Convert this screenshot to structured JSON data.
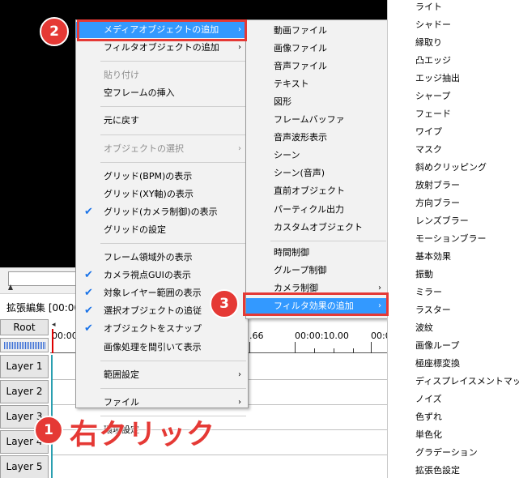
{
  "editor": {
    "title": "拡張編集 [00:00:",
    "root_label": "Root",
    "ruler_labels": [
      "00:00:",
      ".66",
      "00:00:10.00",
      "00:0"
    ],
    "layers": [
      "Layer 1",
      "Layer 2",
      "Layer 3",
      "Layer 4",
      "Layer 5"
    ]
  },
  "menu1": {
    "items": [
      {
        "label": "メディアオブジェクトの追加",
        "submenu": true,
        "highlighted": true
      },
      {
        "label": "フィルタオブジェクトの追加",
        "submenu": true
      },
      {
        "label": "貼り付け",
        "disabled": true
      },
      {
        "label": "空フレームの挿入"
      },
      {
        "label": "元に戻す"
      },
      {
        "label": "オブジェクトの選択",
        "submenu": true,
        "disabled": true
      },
      {
        "label": "グリッド(BPM)の表示"
      },
      {
        "label": "グリッド(XY軸)の表示"
      },
      {
        "label": "グリッド(カメラ制御)の表示",
        "checked": true
      },
      {
        "label": "グリッドの設定"
      },
      {
        "label": "フレーム領域外の表示"
      },
      {
        "label": "カメラ視点GUIの表示",
        "checked": true
      },
      {
        "label": "対象レイヤー範囲の表示",
        "checked": true
      },
      {
        "label": "選択オブジェクトの追従",
        "checked": true
      },
      {
        "label": "オブジェクトをスナップ",
        "checked": true
      },
      {
        "label": "画像処理を間引いて表示"
      },
      {
        "label": "範囲設定",
        "submenu": true
      },
      {
        "label": "ファイル",
        "submenu": true
      },
      {
        "label": "環境設定"
      }
    ]
  },
  "menu2": {
    "items": [
      {
        "label": "動画ファイル"
      },
      {
        "label": "画像ファイル"
      },
      {
        "label": "音声ファイル"
      },
      {
        "label": "テキスト"
      },
      {
        "label": "図形"
      },
      {
        "label": "フレームバッファ"
      },
      {
        "label": "音声波形表示"
      },
      {
        "label": "シーン"
      },
      {
        "label": "シーン(音声)"
      },
      {
        "label": "直前オブジェクト"
      },
      {
        "label": "パーティクル出力"
      },
      {
        "label": "カスタムオブジェクト"
      },
      {
        "label": "時間制御"
      },
      {
        "label": "グループ制御"
      },
      {
        "label": "カメラ制御",
        "submenu": true
      },
      {
        "label": "フィルタ効果の追加",
        "submenu": true,
        "highlighted": true
      }
    ]
  },
  "menu3": {
    "items": [
      "ライト",
      "シャドー",
      "縁取り",
      "凸エッジ",
      "エッジ抽出",
      "シャープ",
      "フェード",
      "ワイプ",
      "マスク",
      "斜めクリッピング",
      "放射ブラー",
      "方向ブラー",
      "レンズブラー",
      "モーションブラー",
      "基本効果",
      "振動",
      "ミラー",
      "ラスター",
      "波紋",
      "画像ループ",
      "極座標変換",
      "ディスプレイスメントマップ",
      "ノイズ",
      "色ずれ",
      "単色化",
      "グラデーション",
      "拡張色設定"
    ]
  },
  "annotations": {
    "step1": "1",
    "step2": "2",
    "step3": "3",
    "note": "右クリック",
    "accent_color": "#e53935"
  },
  "icons": {
    "submenu": "chevron-right-icon",
    "check": "check-icon"
  },
  "glyphs": {
    "arrow": "›",
    "check": "✔",
    "scroll_left": "◂"
  }
}
